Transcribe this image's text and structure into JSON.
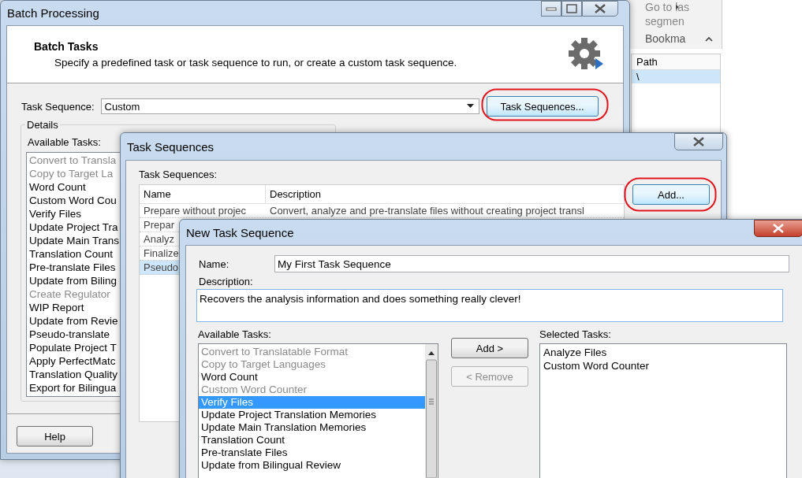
{
  "background_app": {
    "ribbon_items": [
      "Go to las",
      "segmen"
    ],
    "group_label": "Bookma",
    "path_table": {
      "columns": [
        "Path"
      ],
      "rows": [
        {
          "path": "\\",
          "selected": true
        }
      ]
    }
  },
  "batch_window": {
    "title": "Batch Processing",
    "header_title": "Batch Tasks",
    "header_subtitle": "Specify a predefined task or task sequence to run, or create a custom task sequence.",
    "task_sequence_label": "Task Sequence:",
    "task_sequence_value": "Custom",
    "task_sequences_button": {
      "label": "Task Sequences...",
      "highlighted": true
    },
    "details_label": "Details",
    "available_label": "Available Tasks:",
    "available_tasks": [
      {
        "label": "Convert to Transla",
        "disabled": true
      },
      {
        "label": "Copy to Target La",
        "disabled": true
      },
      {
        "label": "Word Count",
        "disabled": false
      },
      {
        "label": "Custom Word Cou",
        "disabled": false
      },
      {
        "label": "Verify Files",
        "disabled": false
      },
      {
        "label": "Update Project Tra",
        "disabled": false
      },
      {
        "label": "Update Main Trans",
        "disabled": false
      },
      {
        "label": "Translation Count",
        "disabled": false
      },
      {
        "label": "Pre-translate Files",
        "disabled": false
      },
      {
        "label": "Update from Biling",
        "disabled": false
      },
      {
        "label": "Create Regulator",
        "disabled": true
      },
      {
        "label": "WIP Report",
        "disabled": false
      },
      {
        "label": "Update from Revie",
        "disabled": false
      },
      {
        "label": "Pseudo-translate",
        "disabled": false
      },
      {
        "label": "Populate Project T",
        "disabled": false
      },
      {
        "label": "Apply PerfectMatc",
        "disabled": false
      },
      {
        "label": "Translation Quality",
        "disabled": false
      },
      {
        "label": "Export for Bilingua",
        "disabled": false
      }
    ],
    "help_button": "Help"
  },
  "sequences_window": {
    "title": "Task Sequences",
    "list_label": "Task Sequences:",
    "columns": [
      "Name",
      "Description"
    ],
    "rows": [
      {
        "name": "Prepare without projec",
        "description": "Convert, analyze and pre-translate files without creating project transl",
        "selected": false
      },
      {
        "name": "Prepar",
        "selected": false
      },
      {
        "name": "Analyz",
        "selected": false
      },
      {
        "name": "Finalize",
        "selected": false
      },
      {
        "name": "Pseudo",
        "selected": true
      }
    ],
    "add_button": {
      "label": "Add...",
      "highlighted": true
    }
  },
  "new_sequence_window": {
    "title": "New Task Sequence",
    "name_label": "Name:",
    "name_value": "My First Task Sequence",
    "description_label": "Description:",
    "description_value": "Recovers the analysis information and does something really clever!",
    "available_label": "Available Tasks:",
    "selected_label": "Selected Tasks:",
    "available_tasks": [
      {
        "label": "Convert to Translatable Format",
        "disabled": true,
        "selected": false
      },
      {
        "label": "Copy to Target Languages",
        "disabled": true,
        "selected": false
      },
      {
        "label": "Word Count",
        "disabled": false,
        "selected": false
      },
      {
        "label": "Custom Word Counter",
        "disabled": true,
        "selected": false
      },
      {
        "label": "Verify Files",
        "disabled": false,
        "selected": true
      },
      {
        "label": "Update Project Translation Memories",
        "disabled": false,
        "selected": false
      },
      {
        "label": "Update Main Translation Memories",
        "disabled": false,
        "selected": false
      },
      {
        "label": "Translation Count",
        "disabled": false,
        "selected": false
      },
      {
        "label": "Pre-translate Files",
        "disabled": false,
        "selected": false
      },
      {
        "label": "Update from Bilingual Review",
        "disabled": false,
        "selected": false
      }
    ],
    "add_button": {
      "label": "Add >",
      "disabled": false
    },
    "remove_button": {
      "label": "< Remove",
      "disabled": true
    },
    "selected_tasks": [
      "Analyze Files",
      "Custom Word Counter"
    ]
  }
}
